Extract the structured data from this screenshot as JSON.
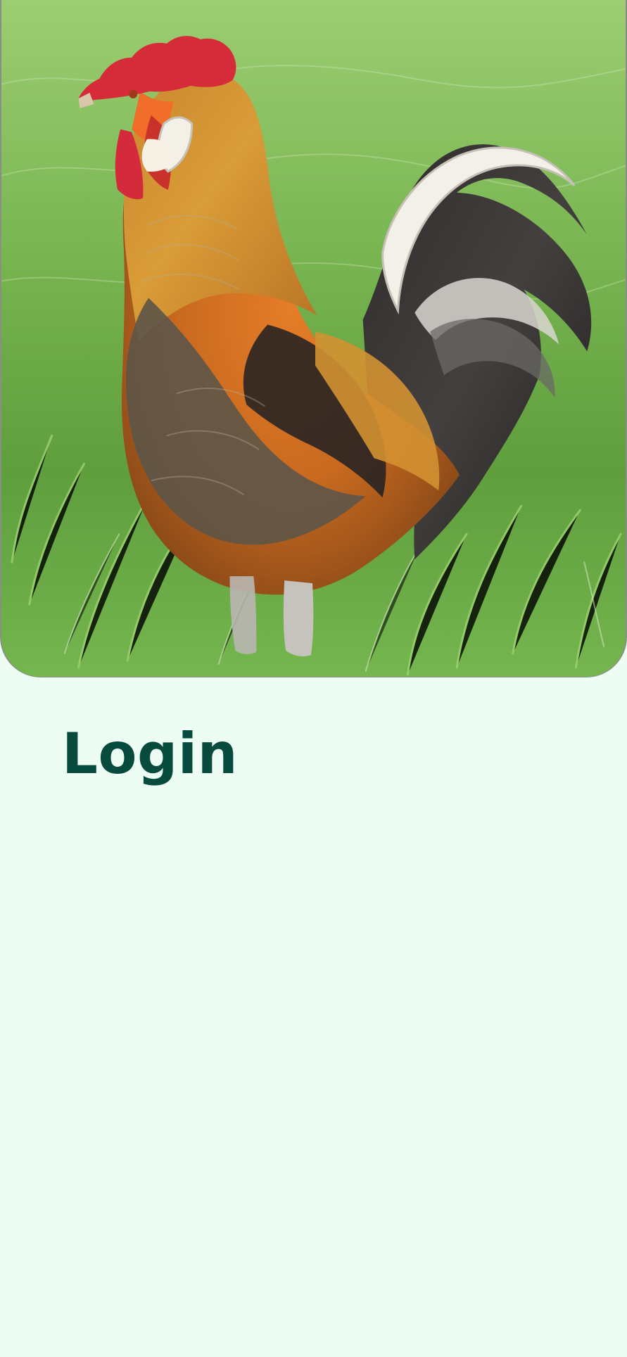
{
  "screen": {
    "title": "Login"
  },
  "hero": {
    "subject": "rooster"
  }
}
